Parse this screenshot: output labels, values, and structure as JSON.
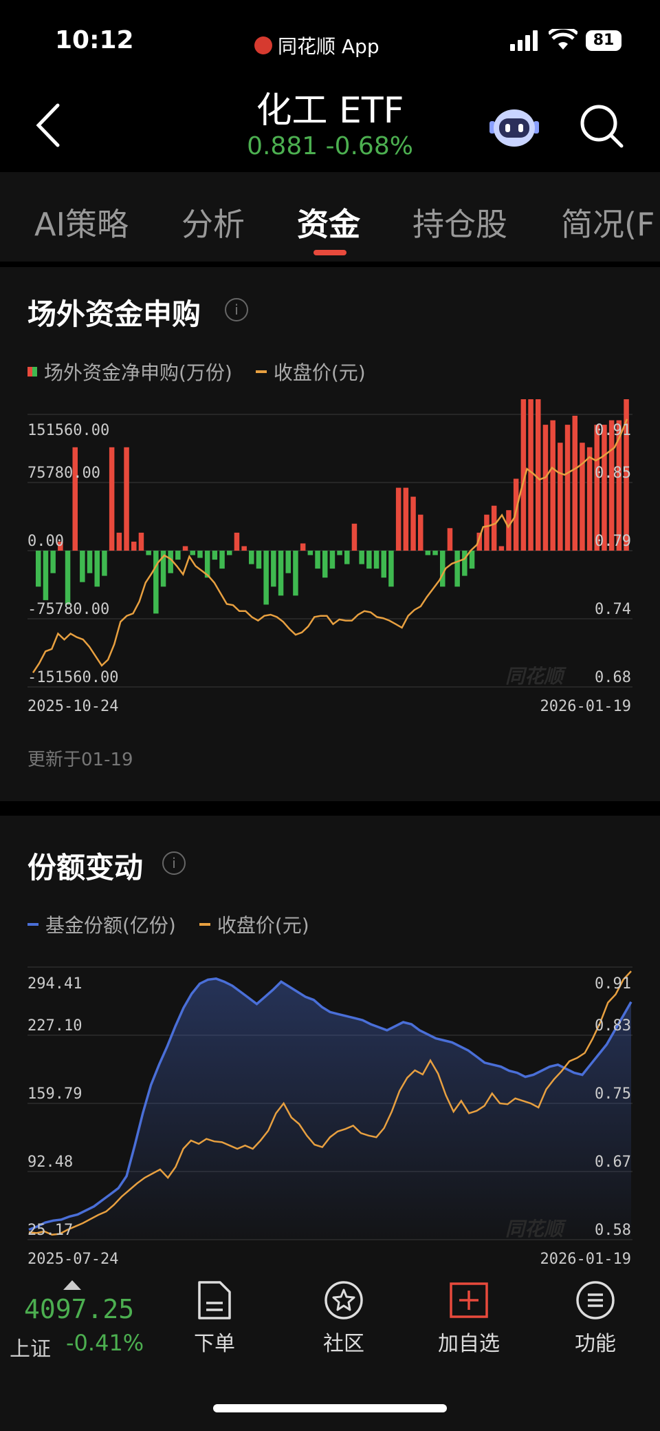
{
  "status": {
    "time": "10:12",
    "app": "同花顺 App",
    "battery": "81"
  },
  "header": {
    "title": "化工 ETF",
    "price": "0.881",
    "change": "-0.68%"
  },
  "tabs": [
    {
      "label": "AI策略"
    },
    {
      "label": "分析"
    },
    {
      "label": "资金",
      "active": true
    },
    {
      "label": "持仓股"
    },
    {
      "label": "简况(F"
    }
  ],
  "section1": {
    "title": "场外资金申购",
    "legend": [
      {
        "label": "场外资金净申购(万份)"
      },
      {
        "label": "收盘价(元)"
      }
    ],
    "yleft": [
      "151560.00",
      "75780.00",
      "0.00",
      "-75780.00",
      "-151560.00"
    ],
    "yright": [
      "0.91",
      "0.85",
      "0.79",
      "0.74",
      "0.68"
    ],
    "xstart": "2025-10-24",
    "xend": "2026-01-19",
    "watermark": "同花顺",
    "updated": "更新于01-19"
  },
  "section2": {
    "title": "份额变动",
    "legend": [
      {
        "label": "基金份额(亿份)"
      },
      {
        "label": "收盘价(元)"
      }
    ],
    "yleft": [
      "294.41",
      "227.10",
      "159.79",
      "92.48",
      "25.17"
    ],
    "yright": [
      "0.91",
      "0.83",
      "0.75",
      "0.67",
      "0.58"
    ],
    "xstart": "2025-07-24",
    "xend": "2026-01-19",
    "watermark": "同花顺"
  },
  "colors": {
    "up": "#e84a3c",
    "down": "#3fb950",
    "price": "#e8a040",
    "shares": "#4a6fd8",
    "accent": "#e84a3c"
  },
  "bottom": {
    "index_value": "4097.25",
    "index_name": "上证",
    "index_change": "-0.41%",
    "nav": [
      {
        "label": "下单",
        "icon": "document-icon"
      },
      {
        "label": "社区",
        "icon": "star-circle-icon"
      },
      {
        "label": "加自选",
        "icon": "add-box-icon"
      },
      {
        "label": "功能",
        "icon": "menu-circle-icon"
      }
    ]
  },
  "chart_data": [
    {
      "type": "bar",
      "title": "场外资金申购",
      "x_range": [
        "2025-10-24",
        "2026-01-19"
      ],
      "ylim": [
        -151560,
        151560
      ],
      "y2lim": [
        0.68,
        0.91
      ],
      "series": [
        {
          "name": "场外资金净申购(万份)",
          "type": "bar",
          "values": [
            -40000,
            -55000,
            -25000,
            10000,
            -60000,
            115000,
            -35000,
            -25000,
            -40000,
            -28000,
            115000,
            20000,
            115000,
            10000,
            20000,
            -5000,
            -70000,
            -40000,
            -25000,
            -10000,
            5000,
            -5000,
            -8000,
            -30000,
            -10000,
            -20000,
            -5000,
            20000,
            5000,
            -15000,
            -20000,
            -60000,
            -40000,
            -50000,
            -25000,
            -50000,
            8000,
            -5000,
            -20000,
            -30000,
            -20000,
            -5000,
            -15000,
            30000,
            -15000,
            -20000,
            -20000,
            -30000,
            -40000,
            70000,
            70000,
            60000,
            40000,
            -5000,
            -5000,
            -40000,
            25000,
            -40000,
            -28000,
            -20000,
            20000,
            40000,
            50000,
            5000,
            45000,
            80000,
            215000,
            200000,
            185000,
            140000,
            145000,
            120000,
            140000,
            150000,
            120000,
            115000,
            140000,
            140000,
            145000,
            145000,
            210000
          ]
        },
        {
          "name": "收盘价(元)",
          "type": "line",
          "values": [
            0.692,
            0.7,
            0.71,
            0.712,
            0.725,
            0.72,
            0.725,
            0.722,
            0.72,
            0.714,
            0.706,
            0.698,
            0.703,
            0.716,
            0.735,
            0.74,
            0.742,
            0.752,
            0.768,
            0.776,
            0.785,
            0.791,
            0.788,
            0.782,
            0.775,
            0.79,
            0.782,
            0.778,
            0.774,
            0.768,
            0.759,
            0.75,
            0.749,
            0.744,
            0.744,
            0.739,
            0.736,
            0.74,
            0.741,
            0.739,
            0.735,
            0.729,
            0.724,
            0.726,
            0.731,
            0.739,
            0.74,
            0.74,
            0.733,
            0.737,
            0.736,
            0.736,
            0.741,
            0.744,
            0.743,
            0.739,
            0.738,
            0.736,
            0.733,
            0.73,
            0.74,
            0.745,
            0.748,
            0.756,
            0.763,
            0.77,
            0.78,
            0.784,
            0.786,
            0.788,
            0.795,
            0.8,
            0.815,
            0.816,
            0.818,
            0.825,
            0.815,
            0.823,
            0.845,
            0.864,
            0.86,
            0.855,
            0.857,
            0.865,
            0.861,
            0.859,
            0.862,
            0.865,
            0.869,
            0.874,
            0.871,
            0.874,
            0.878,
            0.882,
            0.893,
            0.906
          ]
        }
      ]
    },
    {
      "type": "area",
      "title": "份额变动",
      "x_range": [
        "2025-07-24",
        "2026-01-19"
      ],
      "ylim": [
        25.17,
        294.41
      ],
      "y2lim": [
        0.58,
        0.91
      ],
      "series": [
        {
          "name": "基金份额(亿份)",
          "type": "area",
          "values": [
            35,
            38,
            42,
            44,
            45,
            48,
            50,
            54,
            58,
            64,
            70,
            76,
            88,
            118,
            150,
            178,
            198,
            216,
            236,
            254,
            268,
            278,
            282,
            283,
            280,
            276,
            270,
            264,
            258,
            265,
            272,
            280,
            275,
            270,
            265,
            262,
            255,
            250,
            248,
            246,
            244,
            242,
            238,
            235,
            232,
            236,
            240,
            238,
            232,
            228,
            224,
            222,
            220,
            216,
            212,
            206,
            200,
            198,
            196,
            192,
            190,
            186,
            188,
            192,
            196,
            198,
            194,
            190,
            188,
            198,
            208,
            218,
            232,
            246,
            260
          ]
        },
        {
          "name": "收盘价(元)",
          "type": "line",
          "values": [
            0.589,
            0.588,
            0.59,
            0.586,
            0.587,
            0.592,
            0.596,
            0.6,
            0.605,
            0.61,
            0.614,
            0.622,
            0.632,
            0.64,
            0.648,
            0.655,
            0.66,
            0.665,
            0.655,
            0.668,
            0.69,
            0.7,
            0.696,
            0.702,
            0.699,
            0.698,
            0.694,
            0.69,
            0.694,
            0.69,
            0.7,
            0.712,
            0.733,
            0.745,
            0.728,
            0.72,
            0.706,
            0.695,
            0.692,
            0.704,
            0.711,
            0.714,
            0.718,
            0.709,
            0.706,
            0.704,
            0.715,
            0.735,
            0.76,
            0.776,
            0.785,
            0.78,
            0.797,
            0.781,
            0.755,
            0.735,
            0.748,
            0.733,
            0.736,
            0.742,
            0.757,
            0.745,
            0.744,
            0.751,
            0.748,
            0.745,
            0.74,
            0.762,
            0.774,
            0.784,
            0.796,
            0.8,
            0.806,
            0.823,
            0.843,
            0.867,
            0.877,
            0.895,
            0.905
          ]
        }
      ]
    }
  ]
}
